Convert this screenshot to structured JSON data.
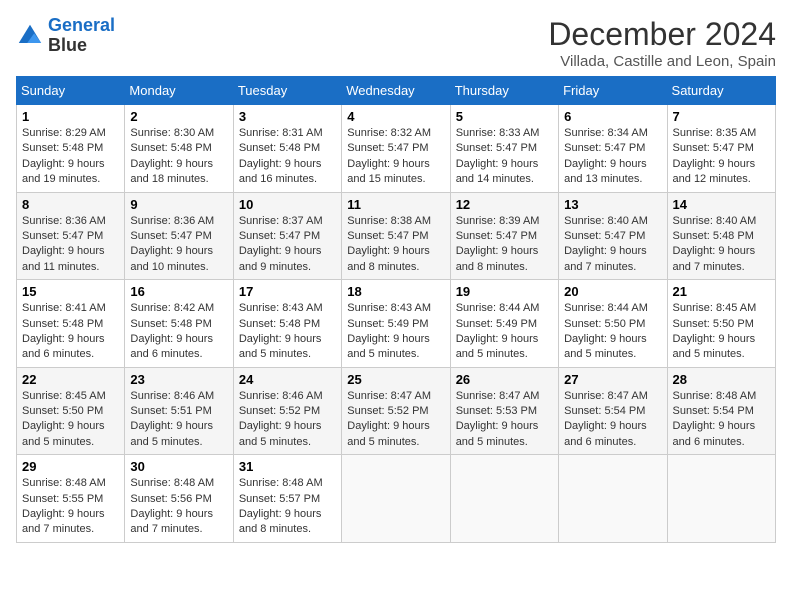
{
  "logo": {
    "line1": "General",
    "line2": "Blue"
  },
  "title": "December 2024",
  "location": "Villada, Castille and Leon, Spain",
  "weekdays": [
    "Sunday",
    "Monday",
    "Tuesday",
    "Wednesday",
    "Thursday",
    "Friday",
    "Saturday"
  ],
  "weeks": [
    [
      {
        "day": "1",
        "sunrise": "8:29 AM",
        "sunset": "5:48 PM",
        "daylight": "9 hours and 19 minutes."
      },
      {
        "day": "2",
        "sunrise": "8:30 AM",
        "sunset": "5:48 PM",
        "daylight": "9 hours and 18 minutes."
      },
      {
        "day": "3",
        "sunrise": "8:31 AM",
        "sunset": "5:48 PM",
        "daylight": "9 hours and 16 minutes."
      },
      {
        "day": "4",
        "sunrise": "8:32 AM",
        "sunset": "5:47 PM",
        "daylight": "9 hours and 15 minutes."
      },
      {
        "day": "5",
        "sunrise": "8:33 AM",
        "sunset": "5:47 PM",
        "daylight": "9 hours and 14 minutes."
      },
      {
        "day": "6",
        "sunrise": "8:34 AM",
        "sunset": "5:47 PM",
        "daylight": "9 hours and 13 minutes."
      },
      {
        "day": "7",
        "sunrise": "8:35 AM",
        "sunset": "5:47 PM",
        "daylight": "9 hours and 12 minutes."
      }
    ],
    [
      {
        "day": "8",
        "sunrise": "8:36 AM",
        "sunset": "5:47 PM",
        "daylight": "9 hours and 11 minutes."
      },
      {
        "day": "9",
        "sunrise": "8:36 AM",
        "sunset": "5:47 PM",
        "daylight": "9 hours and 10 minutes."
      },
      {
        "day": "10",
        "sunrise": "8:37 AM",
        "sunset": "5:47 PM",
        "daylight": "9 hours and 9 minutes."
      },
      {
        "day": "11",
        "sunrise": "8:38 AM",
        "sunset": "5:47 PM",
        "daylight": "9 hours and 8 minutes."
      },
      {
        "day": "12",
        "sunrise": "8:39 AM",
        "sunset": "5:47 PM",
        "daylight": "9 hours and 8 minutes."
      },
      {
        "day": "13",
        "sunrise": "8:40 AM",
        "sunset": "5:47 PM",
        "daylight": "9 hours and 7 minutes."
      },
      {
        "day": "14",
        "sunrise": "8:40 AM",
        "sunset": "5:48 PM",
        "daylight": "9 hours and 7 minutes."
      }
    ],
    [
      {
        "day": "15",
        "sunrise": "8:41 AM",
        "sunset": "5:48 PM",
        "daylight": "9 hours and 6 minutes."
      },
      {
        "day": "16",
        "sunrise": "8:42 AM",
        "sunset": "5:48 PM",
        "daylight": "9 hours and 6 minutes."
      },
      {
        "day": "17",
        "sunrise": "8:43 AM",
        "sunset": "5:48 PM",
        "daylight": "9 hours and 5 minutes."
      },
      {
        "day": "18",
        "sunrise": "8:43 AM",
        "sunset": "5:49 PM",
        "daylight": "9 hours and 5 minutes."
      },
      {
        "day": "19",
        "sunrise": "8:44 AM",
        "sunset": "5:49 PM",
        "daylight": "9 hours and 5 minutes."
      },
      {
        "day": "20",
        "sunrise": "8:44 AM",
        "sunset": "5:50 PM",
        "daylight": "9 hours and 5 minutes."
      },
      {
        "day": "21",
        "sunrise": "8:45 AM",
        "sunset": "5:50 PM",
        "daylight": "9 hours and 5 minutes."
      }
    ],
    [
      {
        "day": "22",
        "sunrise": "8:45 AM",
        "sunset": "5:50 PM",
        "daylight": "9 hours and 5 minutes."
      },
      {
        "day": "23",
        "sunrise": "8:46 AM",
        "sunset": "5:51 PM",
        "daylight": "9 hours and 5 minutes."
      },
      {
        "day": "24",
        "sunrise": "8:46 AM",
        "sunset": "5:52 PM",
        "daylight": "9 hours and 5 minutes."
      },
      {
        "day": "25",
        "sunrise": "8:47 AM",
        "sunset": "5:52 PM",
        "daylight": "9 hours and 5 minutes."
      },
      {
        "day": "26",
        "sunrise": "8:47 AM",
        "sunset": "5:53 PM",
        "daylight": "9 hours and 5 minutes."
      },
      {
        "day": "27",
        "sunrise": "8:47 AM",
        "sunset": "5:54 PM",
        "daylight": "9 hours and 6 minutes."
      },
      {
        "day": "28",
        "sunrise": "8:48 AM",
        "sunset": "5:54 PM",
        "daylight": "9 hours and 6 minutes."
      }
    ],
    [
      {
        "day": "29",
        "sunrise": "8:48 AM",
        "sunset": "5:55 PM",
        "daylight": "9 hours and 7 minutes."
      },
      {
        "day": "30",
        "sunrise": "8:48 AM",
        "sunset": "5:56 PM",
        "daylight": "9 hours and 7 minutes."
      },
      {
        "day": "31",
        "sunrise": "8:48 AM",
        "sunset": "5:57 PM",
        "daylight": "9 hours and 8 minutes."
      },
      null,
      null,
      null,
      null
    ]
  ]
}
